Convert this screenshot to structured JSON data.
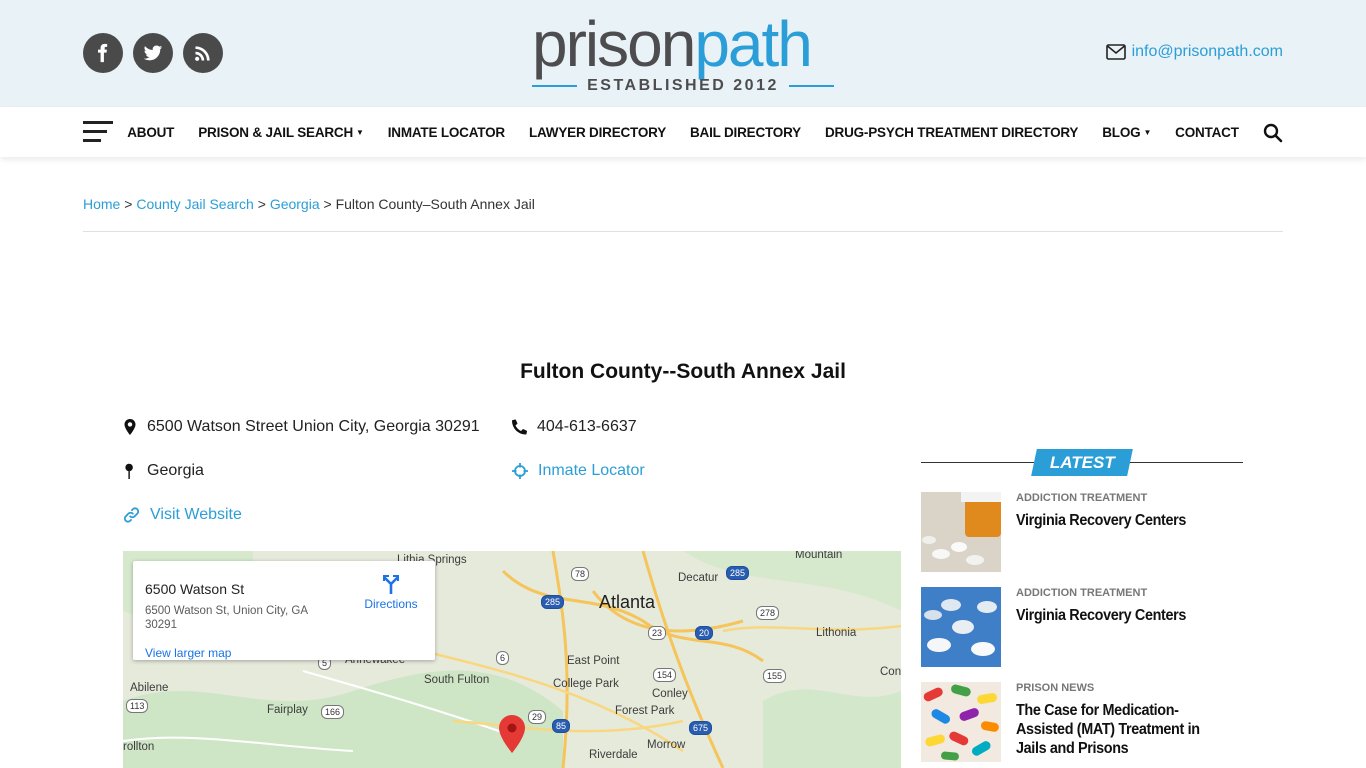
{
  "header": {
    "logo_dark": "prison",
    "logo_blue": "path",
    "logo_established": "ESTABLISHED 2012",
    "email": "info@prisonpath.com",
    "social": [
      "facebook-icon",
      "twitter-icon",
      "rss-icon"
    ]
  },
  "nav": {
    "items": [
      {
        "label": "ABOUT",
        "dropdown": false
      },
      {
        "label": "PRISON & JAIL SEARCH",
        "dropdown": true
      },
      {
        "label": "INMATE LOCATOR",
        "dropdown": false
      },
      {
        "label": "LAWYER DIRECTORY",
        "dropdown": false
      },
      {
        "label": "BAIL DIRECTORY",
        "dropdown": false
      },
      {
        "label": "DRUG-PSYCH TREATMENT DIRECTORY",
        "dropdown": false
      },
      {
        "label": "BLOG",
        "dropdown": true
      },
      {
        "label": "CONTACT",
        "dropdown": false
      }
    ]
  },
  "breadcrumb": {
    "home": "Home",
    "county": "County Jail Search",
    "state": "Georgia",
    "current": "Fulton County–South Annex Jail",
    "sep": ">"
  },
  "jail": {
    "title": "Fulton County--South Annex Jail",
    "address": "6500 Watson Street Union City, Georgia 30291",
    "phone": "404-613-6637",
    "state": "Georgia",
    "inmate_locator": "Inmate Locator",
    "website": "Visit Website"
  },
  "map": {
    "card_title": "6500 Watson St",
    "card_address": "6500 Watson St, Union City, GA 30291",
    "directions": "Directions",
    "larger_map": "View larger map",
    "labels": {
      "atlanta": "Atlanta",
      "decatur": "Decatur",
      "mountain": "Mountain",
      "lithia_springs": "Lithia Springs",
      "lithonia": "Lithonia",
      "east_point": "East Point",
      "college_park": "College Park",
      "south_fulton": "South Fulton",
      "conley": "Conley",
      "forest_park": "Forest Park",
      "morrow": "Morrow",
      "riverdale": "Riverdale",
      "abilene": "Abilene",
      "fairplay": "Fairplay",
      "rollton": "rollton",
      "annewakee": "Annewakee",
      "con": "Con"
    },
    "shields": [
      "78",
      "285",
      "285",
      "278",
      "23",
      "20",
      "6",
      "5",
      "154",
      "155",
      "166",
      "113",
      "29",
      "85",
      "675"
    ]
  },
  "sidebar": {
    "latest": "LATEST",
    "posts": [
      {
        "category": "ADDICTION TREATMENT",
        "title": "Virginia Recovery Centers"
      },
      {
        "category": "ADDICTION TREATMENT",
        "title": "Virginia Recovery Centers"
      },
      {
        "category": "PRISON NEWS",
        "title": "The Case for Medication-Assisted (MAT) Treatment in Jails and Prisons"
      }
    ]
  },
  "colors": {
    "accent": "#2b9ed8",
    "header_bg": "#e9f2f6",
    "map_pin": "#e53935"
  }
}
